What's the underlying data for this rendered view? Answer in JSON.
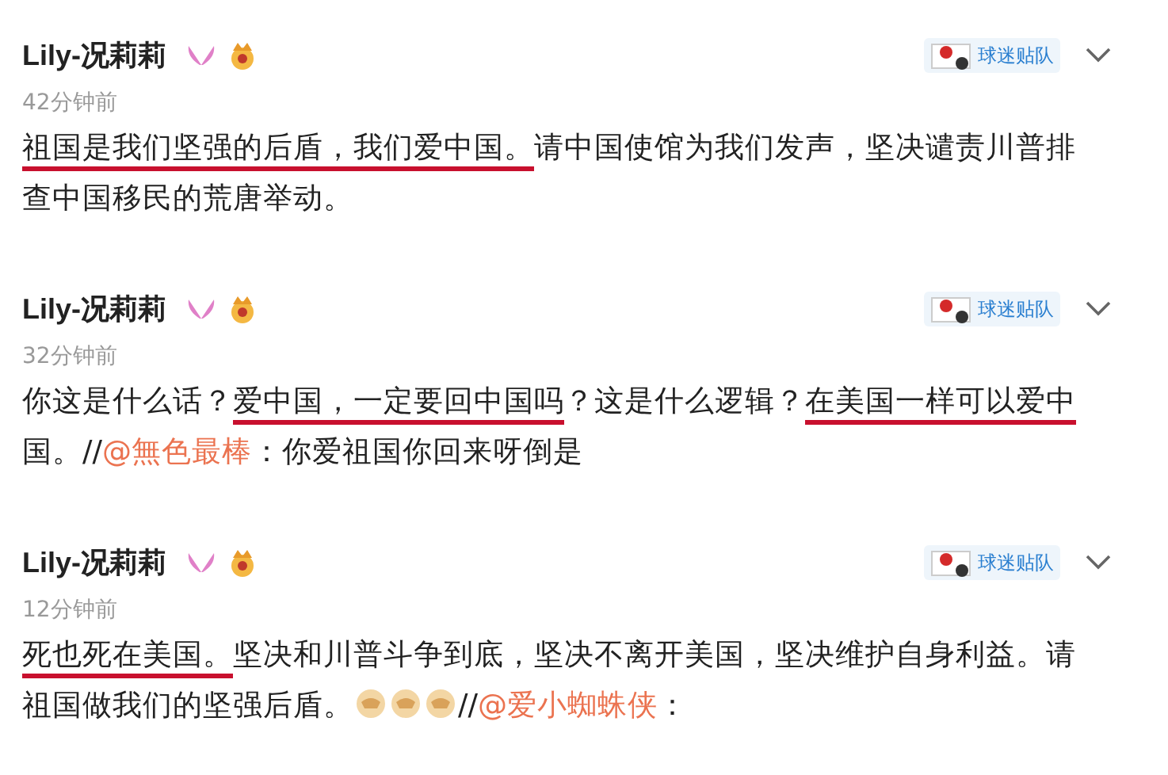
{
  "posts": [
    {
      "author": "Lily-况莉莉",
      "time": "42分钟前",
      "badge": "球迷贴队",
      "segments": [
        {
          "kind": "text",
          "text": "祖国是我们坚强的后盾，我们爱中国。",
          "underlined": true
        },
        {
          "kind": "text",
          "text": "请中国使馆为我们发声，坚决谴责川普排查中国移民的荒唐举动。",
          "underlined": false
        }
      ]
    },
    {
      "author": "Lily-况莉莉",
      "time": "32分钟前",
      "badge": "球迷贴队",
      "segments": [
        {
          "kind": "text",
          "text": "你这是什么话？",
          "underlined": false
        },
        {
          "kind": "text",
          "text": "爱中国，一定要回中国吗",
          "underlined": true
        },
        {
          "kind": "text",
          "text": "？这是什么逻辑？",
          "underlined": false
        },
        {
          "kind": "text",
          "text": "在美国一样可以爱中",
          "underlined": true
        },
        {
          "kind": "text",
          "text": "国。//",
          "underlined": false
        },
        {
          "kind": "mention",
          "text": "@無色最棒"
        },
        {
          "kind": "text",
          "text": "：你爱祖国你回来呀倒是",
          "underlined": false
        }
      ]
    },
    {
      "author": "Lily-况莉莉",
      "time": "12分钟前",
      "badge": "球迷贴队",
      "segments": [
        {
          "kind": "text",
          "text": "死也死在美国。",
          "underlined": true
        },
        {
          "kind": "text",
          "text": "坚决和川普斗争到底，坚决不离开美国，坚决维护自身利益。请祖国做我们的坚强后盾。",
          "underlined": false
        },
        {
          "kind": "emoji"
        },
        {
          "kind": "emoji"
        },
        {
          "kind": "emoji"
        },
        {
          "kind": "text",
          "text": "//",
          "underlined": false
        },
        {
          "kind": "mention",
          "text": "@爱小蜘蛛侠"
        },
        {
          "kind": "text",
          "text": "：",
          "underlined": false
        }
      ]
    }
  ]
}
